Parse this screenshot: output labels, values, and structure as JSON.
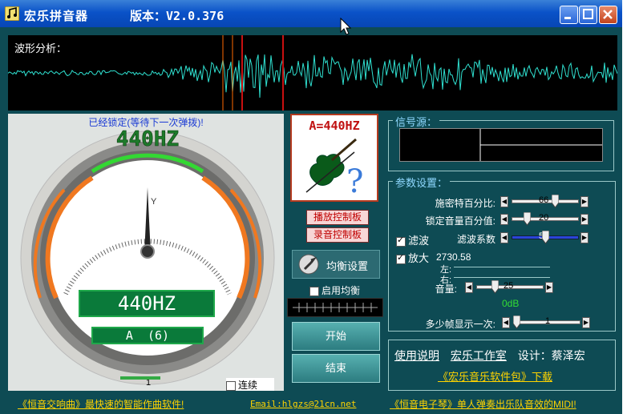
{
  "window": {
    "title": "宏乐拼音器",
    "version": "版本：V2.0.376"
  },
  "waveform": {
    "label": "波形分析："
  },
  "tuner": {
    "lock_status": "已经锁定(等待下一次弹拨)!",
    "top_display": "440HZ",
    "freq_display": "440HZ",
    "note_display": "A  (6)",
    "bottom_number": "1",
    "continuous_label": "连续",
    "continuous_checked": false
  },
  "badge": {
    "text": "A=440HZ"
  },
  "buttons": {
    "playback_panel": "播放控制板",
    "record_panel": "录音控制板",
    "equalizer": "均衡设置",
    "enable_eq": "启用均衡",
    "start": "开始",
    "stop": "结束"
  },
  "signal": {
    "title": "信号源："
  },
  "params": {
    "title": "参数设置：",
    "schmitt": {
      "label": "施密特百分比:",
      "value": "66",
      "level": 0.66
    },
    "lock_vol": {
      "label": "锁定音量百分值:",
      "value": "20",
      "level": 0.2
    },
    "filter": {
      "label": "滤波",
      "checked": true,
      "coef_label": "滤波系数",
      "value": "50",
      "level": 0.5
    },
    "amplify": {
      "label": "放大",
      "checked": true,
      "value": "2730.58"
    },
    "left_label": "左:",
    "right_label": "右:",
    "volume": {
      "label": "音量:",
      "value": "25",
      "level": 0.25
    },
    "db": "0dB",
    "frames": {
      "label": "多少帧显示一次:",
      "value": "1",
      "level": 0.0
    }
  },
  "links": {
    "help": "使用说明",
    "studio": "宏乐工作室",
    "design": "设计：蔡泽宏",
    "package": "《宏乐音乐软件包》下载",
    "ad_left": "《恒音交响曲》最快速的智能作曲软件!",
    "email": "Email:hlgzs@21cn.net",
    "ad_right": "《恒音电子琴》单人弹奏出乐队音效的MIDI!"
  },
  "colors": {
    "bg": "#0e4b54",
    "accent": "#ffd400",
    "lcd": "#0a7a3a"
  }
}
